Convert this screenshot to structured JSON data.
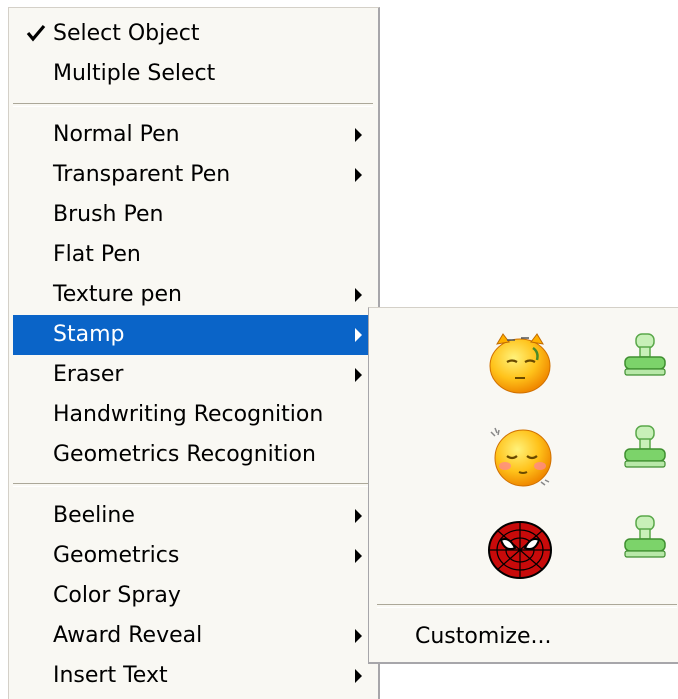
{
  "menu": {
    "items": [
      {
        "label": "Select Object",
        "checked": true
      },
      {
        "label": "Multiple Select"
      },
      {
        "label": "Normal Pen",
        "submenu": true
      },
      {
        "label": "Transparent Pen",
        "submenu": true
      },
      {
        "label": "Brush Pen"
      },
      {
        "label": "Flat Pen"
      },
      {
        "label": "Texture pen",
        "submenu": true
      },
      {
        "label": "Stamp",
        "submenu": true,
        "highlighted": true
      },
      {
        "label": "Eraser",
        "submenu": true
      },
      {
        "label": "Handwriting Recognition"
      },
      {
        "label": "Geometrics Recognition"
      },
      {
        "label": "Beeline",
        "submenu": true
      },
      {
        "label": "Geometrics",
        "submenu": true
      },
      {
        "label": "Color Spray"
      },
      {
        "label": "Award Reveal",
        "submenu": true
      },
      {
        "label": "Insert Text",
        "submenu": true
      }
    ]
  },
  "stamp_submenu": {
    "stamps": [
      {
        "icon": "sleepy-yellow-face-icon"
      },
      {
        "icon": "shy-blushing-face-icon"
      },
      {
        "icon": "spiderman-mask-icon"
      }
    ],
    "customize_label": "Customize..."
  },
  "colors": {
    "highlight": "#0a64c8",
    "menu_background": "#f9f8f3",
    "stamp_green": "#7cd36a"
  }
}
